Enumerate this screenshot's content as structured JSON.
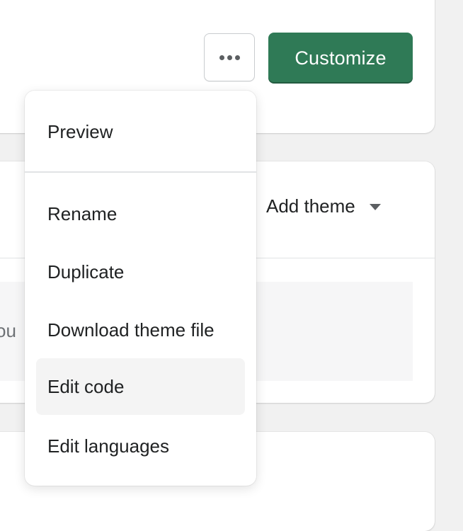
{
  "header": {
    "more_actions_icon": "horizontal-dots-icon",
    "customize_label": "Customize"
  },
  "theme_library": {
    "add_theme_label": "Add theme",
    "add_theme_icon": "caret-down-icon",
    "clipped_text": "ou"
  },
  "menu": {
    "items": [
      {
        "label": "Preview"
      },
      {
        "label": "Rename"
      },
      {
        "label": "Duplicate"
      },
      {
        "label": "Download theme file"
      },
      {
        "label": "Edit code",
        "active": true
      },
      {
        "label": "Edit languages"
      }
    ]
  },
  "colors": {
    "primary_button": "#2f7a56",
    "background": "#f1f1f1",
    "hover": "#f4f4f4"
  }
}
